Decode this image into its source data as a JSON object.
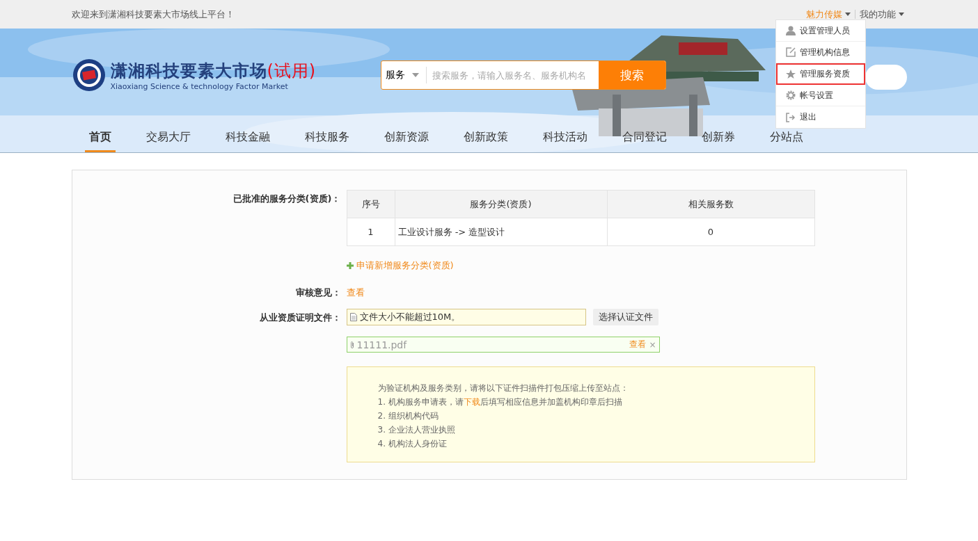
{
  "top_bar": {
    "welcome": "欢迎来到潇湘科技要素大市场线上平台！",
    "user": "魅力传媒",
    "functions": "我的功能"
  },
  "user_menu": [
    {
      "label": "设置管理人员",
      "kind": "person",
      "selected": false
    },
    {
      "label": "管理机构信息",
      "kind": "edit",
      "selected": false
    },
    {
      "label": "管理服务资质",
      "kind": "star",
      "selected": true
    },
    {
      "label": "帐号设置",
      "kind": "gear",
      "selected": false
    },
    {
      "label": "退出",
      "kind": "logout",
      "selected": false
    }
  ],
  "logo": {
    "title": "潇湘科技要素大市场",
    "badge": "(试用)",
    "subtitle": "Xiaoxiang Science & technology Factor Market"
  },
  "search": {
    "scope": "服务",
    "placeholder": "搜索服务，请输入服务名、服务机构名",
    "button": "搜索"
  },
  "nav": [
    {
      "label": "首页",
      "selected": true
    },
    {
      "label": "交易大厅",
      "selected": false
    },
    {
      "label": "科技金融",
      "selected": false
    },
    {
      "label": "科技服务",
      "selected": false
    },
    {
      "label": "创新资源",
      "selected": false
    },
    {
      "label": "创新政策",
      "selected": false
    },
    {
      "label": "科技活动",
      "selected": false
    },
    {
      "label": "合同登记",
      "selected": false
    },
    {
      "label": "创新券",
      "selected": false
    },
    {
      "label": "分站点",
      "selected": false
    }
  ],
  "form": {
    "approved_label": "已批准的服务分类(资质)：",
    "table": {
      "columns": [
        "序号",
        "服务分类(资质)",
        "相关服务数"
      ],
      "rows": [
        [
          "1",
          "工业设计服务 -> 造型设计",
          "0"
        ]
      ]
    },
    "add_link": "申请新增服务分类(资质)",
    "review_label": "审核意见：",
    "review_link": "查看",
    "file_label": "从业资质证明文件：",
    "file_hint": "文件大小不能超过10M。",
    "choose_button": "选择认证文件",
    "uploaded": {
      "name": "11111.pdf",
      "view": "查看",
      "remove": "×"
    },
    "notes": {
      "intro": "为验证机构及服务类别，请将以下证件扫描件打包压缩上传至站点：",
      "items": [
        {
          "text": "1. 机构服务申请表，请",
          "link": "下载",
          "after": "后填写相应信息并加盖机构印章后扫描"
        },
        {
          "text": "2. 组织机构代码"
        },
        {
          "text": "3. 企业法人营业执照"
        },
        {
          "text": "4. 机构法人身份证"
        }
      ]
    }
  }
}
